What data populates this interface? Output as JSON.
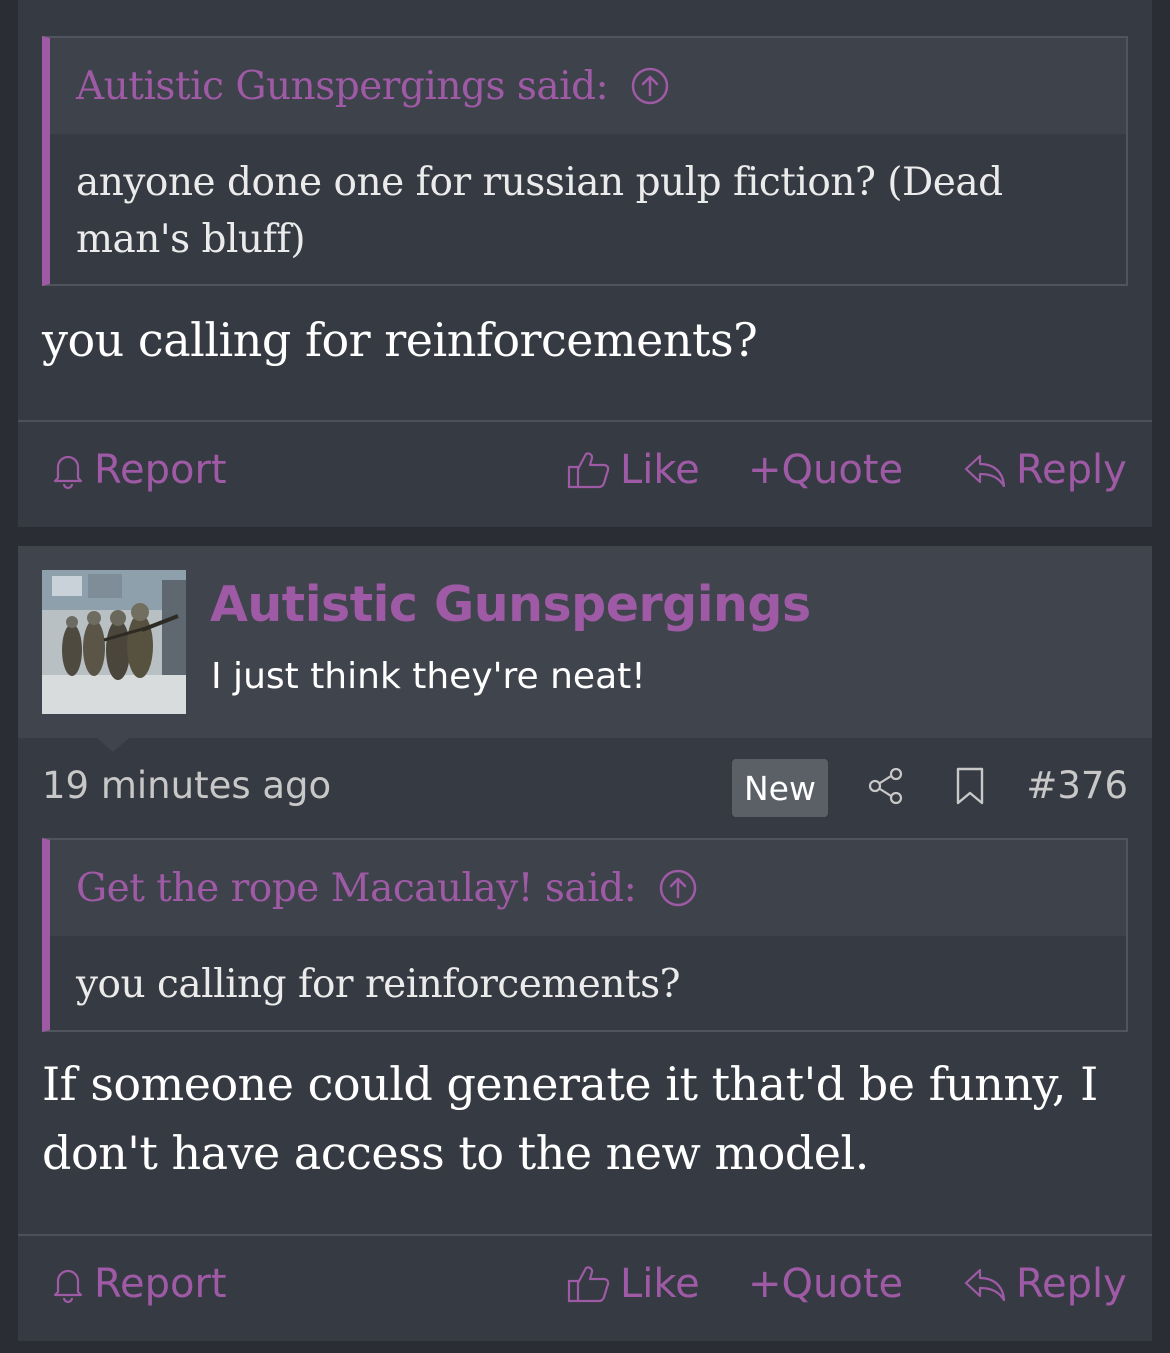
{
  "posts": [
    {
      "quote": {
        "author_said": "Autistic Gunspergings said:",
        "text": "anyone done one for russian pulp fiction? (Dead man's bluff)"
      },
      "body": "you calling for reinforcements?",
      "actions": {
        "report": "Report",
        "like": "Like",
        "quote": "+Quote",
        "reply": "Reply"
      }
    },
    {
      "author": {
        "name": "Autistic Gunspergings",
        "title": "I just think they're neat!"
      },
      "meta": {
        "time": "19 minutes ago",
        "badge": "New",
        "post_number": "#376"
      },
      "quote": {
        "author_said": "Get the rope Macaulay! said:",
        "text": "you calling for reinforcements?"
      },
      "body": "If someone could generate it that'd be funny, I don't have access to the new model.",
      "actions": {
        "report": "Report",
        "like": "Like",
        "quote": "+Quote",
        "reply": "Reply"
      }
    }
  ],
  "icons": {
    "jump": "arrow-up-circle-icon",
    "report": "bell-icon",
    "like": "thumbs-up-icon",
    "reply": "reply-arrow-icon",
    "share": "share-icon",
    "bookmark": "bookmark-icon"
  },
  "colors": {
    "accent": "#9f5aa6",
    "post_bg": "#363a42",
    "header_bg": "#40444c",
    "page_bg": "#2a2d33"
  }
}
